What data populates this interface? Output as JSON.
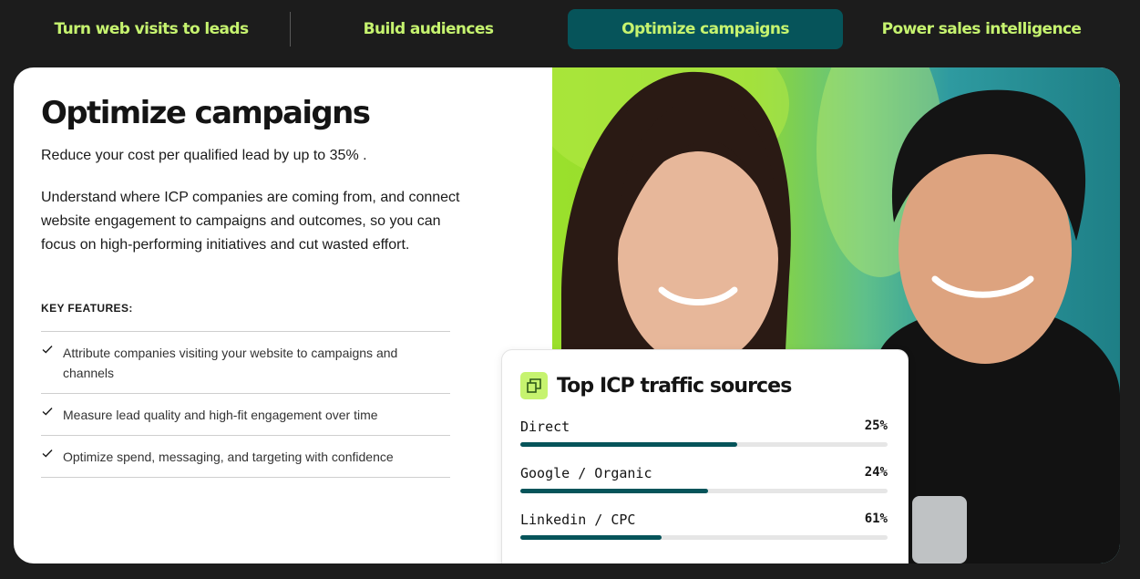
{
  "tabs": [
    {
      "label": "Turn web visits to leads",
      "active": false
    },
    {
      "label": "Build audiences",
      "active": false
    },
    {
      "label": "Optimize campaigns",
      "active": true
    },
    {
      "label": "Power sales intelligence",
      "active": false
    }
  ],
  "content": {
    "title": "Optimize campaigns",
    "lead": "Reduce your cost per qualified lead by up to 35% .",
    "description": "Understand where ICP companies are coming from, and connect website engagement to campaigns and outcomes, so you can focus on high-performing initiatives and cut wasted effort.",
    "key_features_label": "KEY FEATURES:",
    "features": [
      {
        "text": "Attribute companies visiting your website to campaigns and channels",
        "icon": "check-icon"
      },
      {
        "text": "Measure lead quality and high-fit engagement over time",
        "icon": "check-icon"
      },
      {
        "text": "Optimize spend, messaging, and targeting with confidence",
        "icon": "check-icon"
      }
    ]
  },
  "traffic_card": {
    "icon": "chart-icon",
    "title": "Top ICP traffic sources",
    "rows": [
      {
        "label": "Direct",
        "value": "25%",
        "bar_fraction": 0.59
      },
      {
        "label": "Google / Organic",
        "value": "24%",
        "bar_fraction": 0.51
      },
      {
        "label": "Linkedin / CPC",
        "value": "61%",
        "bar_fraction": 0.385
      }
    ]
  },
  "colors": {
    "accent_green": "#c6f36f",
    "accent_teal": "#06545a",
    "background": "#1c1c1c"
  }
}
